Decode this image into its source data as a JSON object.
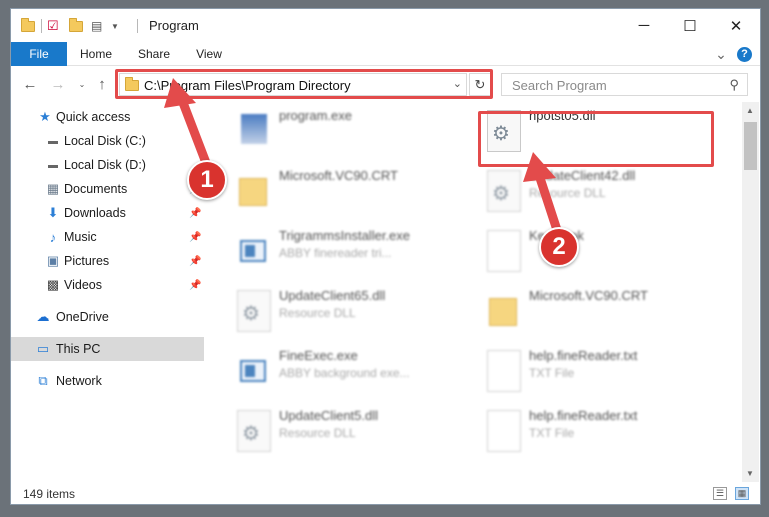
{
  "window": {
    "title": "Program",
    "controls": {
      "minimize": "─",
      "maximize": "☐",
      "close": "✕"
    }
  },
  "ribbon": {
    "tabs": [
      "File",
      "Home",
      "Share",
      "View"
    ],
    "expand": "⌄",
    "help": "?"
  },
  "address_bar": {
    "path": "C:\\Program Files\\Program Directory",
    "search_placeholder": "Search Program"
  },
  "nav": {
    "items": [
      {
        "label": "Quick access",
        "icon": "star-icon",
        "pinned": false
      },
      {
        "label": "Local Disk (C:)",
        "icon": "drive-icon",
        "pinned": false
      },
      {
        "label": "Local Disk (D:)",
        "icon": "drive-icon",
        "pinned": false
      },
      {
        "label": "Documents",
        "icon": "documents-icon",
        "pinned": true
      },
      {
        "label": "Downloads",
        "icon": "download-icon",
        "pinned": true
      },
      {
        "label": "Music",
        "icon": "music-icon",
        "pinned": true
      },
      {
        "label": "Pictures",
        "icon": "pictures-icon",
        "pinned": true
      },
      {
        "label": "Videos",
        "icon": "videos-icon",
        "pinned": true
      },
      {
        "label": "OneDrive",
        "icon": "cloud-icon",
        "pinned": false
      },
      {
        "label": "This PC",
        "icon": "computer-icon",
        "pinned": false,
        "selected": true
      },
      {
        "label": "Network",
        "icon": "network-icon",
        "pinned": false
      }
    ]
  },
  "files": [
    {
      "name": "program.exe",
      "sub": "",
      "kind": "exe"
    },
    {
      "name": "hpotst05.dll",
      "sub": "",
      "kind": "dll"
    },
    {
      "name": "Microsoft.VC90.CRT",
      "sub": "",
      "kind": "folder"
    },
    {
      "name": "UpdateClient42.dll",
      "sub": "Resource DLL",
      "kind": "dll"
    },
    {
      "name": "TrigrammsInstaller.exe",
      "sub": "ABBY finereader tri...",
      "kind": "app"
    },
    {
      "name": "Kernel.pk",
      "sub": "",
      "kind": "doc"
    },
    {
      "name": "UpdateClient65.dll",
      "sub": "Resource DLL",
      "kind": "dll"
    },
    {
      "name": "Microsoft.VC90.CRT",
      "sub": "",
      "kind": "folder"
    },
    {
      "name": "FineExec.exe",
      "sub": "ABBY background exe...",
      "kind": "app"
    },
    {
      "name": "help.fineReader.txt",
      "sub": "TXT File",
      "kind": "doc"
    },
    {
      "name": "UpdateClient5.dll",
      "sub": "Resource DLL",
      "kind": "dll"
    },
    {
      "name": "help.fineReader.txt",
      "sub": "TXT File",
      "kind": "doc"
    }
  ],
  "annotations": {
    "step1": "1",
    "step2": "2",
    "highlight_color": "#e34b4b"
  },
  "status": {
    "item_count": "149 items"
  }
}
